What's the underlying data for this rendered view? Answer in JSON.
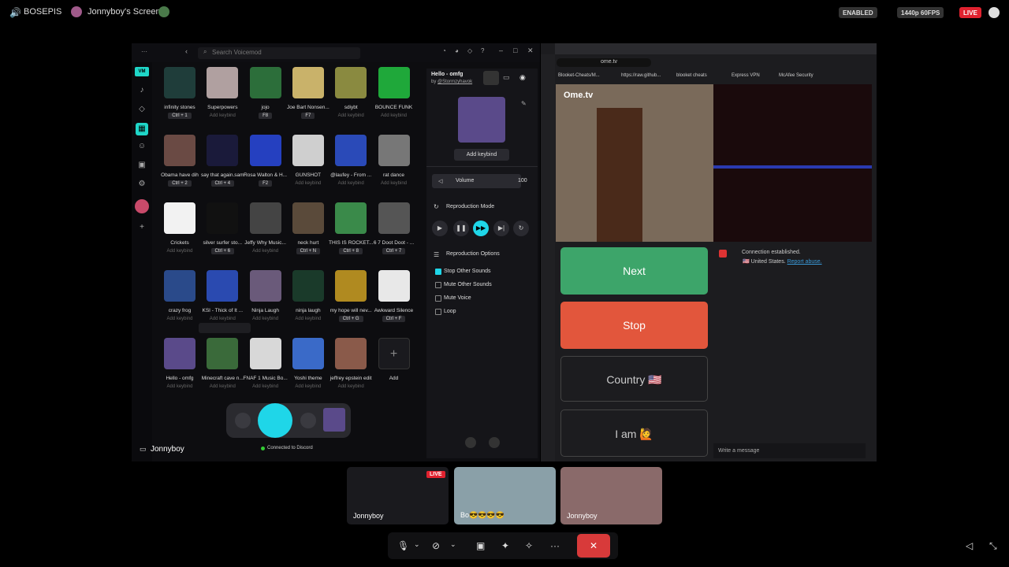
{
  "topbar": {
    "server": "BOSEPIS",
    "screen_title": "Jonnyboy's Screen",
    "enabled": "ENABLED",
    "quality": "1440p 60FPS",
    "live": "LIVE"
  },
  "voicemod": {
    "search_placeholder": "Search Voicemod",
    "user": "Jonnyboy",
    "status": "Connected to Discord",
    "sounds": [
      {
        "name": "infinity stones",
        "key": "Ctrl + 1",
        "color": "#1f3d3a"
      },
      {
        "name": "Superpowers",
        "key": "Add keybind",
        "color": "#b0a0a0"
      },
      {
        "name": "jojo",
        "key": "F8",
        "color": "#2c6e3a"
      },
      {
        "name": "Joe Bart Nonsen...",
        "key": "F7",
        "color": "#c9b26a"
      },
      {
        "name": "sdiybt",
        "key": "Add keybind",
        "color": "#8a8a40"
      },
      {
        "name": "BOUNCE FUNK",
        "key": "Add keybind",
        "color": "#1fa83a"
      },
      {
        "name": "Obama have dih",
        "key": "Ctrl + 2",
        "color": "#6a4a44"
      },
      {
        "name": "say that again.sam",
        "key": "Ctrl + 4",
        "color": "#1a1a3a"
      },
      {
        "name": "Rosa Walton & H...",
        "key": "F2",
        "color": "#2540c0"
      },
      {
        "name": "GUNSHOT",
        "key": "Add keybind",
        "color": "#cfcfcf"
      },
      {
        "name": "@laufey - From ...",
        "key": "Add keybind",
        "color": "#2a4ab8"
      },
      {
        "name": "rat dance",
        "key": "Add keybind",
        "color": "#777"
      },
      {
        "name": "Crickets",
        "key": "Add keybind",
        "color": "#f2f2f2"
      },
      {
        "name": "silver surfer sto...",
        "key": "Ctrl + 6",
        "color": "#111"
      },
      {
        "name": "Jeffy Why Music...",
        "key": "Add keybind",
        "color": "#444"
      },
      {
        "name": "neck hurt",
        "key": "Ctrl + N",
        "color": "#5a4a3a"
      },
      {
        "name": "THIS IS ROCKET...",
        "key": "Ctrl + 8",
        "color": "#3a8a4a"
      },
      {
        "name": "6 7 Doot Doot - ...",
        "key": "Ctrl + 7",
        "color": "#555"
      },
      {
        "name": "crazy frog",
        "key": "Add keybind",
        "color": "#2a4a8a"
      },
      {
        "name": "KSI - Thick of It ...",
        "key": "Add keybind",
        "color": "#2a4ab0"
      },
      {
        "name": "Ninja Laugh",
        "key": "Add keybind",
        "color": "#6a5a7a"
      },
      {
        "name": "ninja laugh",
        "key": "Add keybind",
        "color": "#1a3a2a"
      },
      {
        "name": "my hope will nev...",
        "key": "Ctrl + G",
        "color": "#b08a20"
      },
      {
        "name": "Awkward Silence",
        "key": "Ctrl + F",
        "color": "#e8e8e8"
      },
      {
        "name": "Hello - omfg",
        "key": "Add keybind",
        "color": "#5a4a8a"
      },
      {
        "name": "Minecraft cave n...",
        "key": "Add keybind",
        "color": "#3a6a3a"
      },
      {
        "name": "FNAF 1 Music Bo...",
        "key": "Add keybind",
        "color": "#d8d8d8"
      },
      {
        "name": "Yoshi theme",
        "key": "Add keybind",
        "color": "#3a6ac8"
      },
      {
        "name": "jeffrey epstein edit",
        "key": "Add keybind",
        "color": "#8a5a4a"
      },
      {
        "name": "Add",
        "key": "",
        "color": "#1a1a1e"
      }
    ],
    "selected": {
      "title": "Hello - omfg",
      "author": "@Stormzyhavok",
      "by": "by",
      "add_keybind": "Add keybind",
      "volume_label": "Volume",
      "volume": "100",
      "repro_mode": "Reproduction Mode",
      "repro_options": "Reproduction Options",
      "opts": [
        "Stop Other Sounds",
        "Mute Other Sounds",
        "Mute Voice",
        "Loop"
      ]
    }
  },
  "browser": {
    "url": "ome.tv",
    "bookmarks": [
      "Blooket-Cheats/M...",
      "https://raw.github...",
      "blooket cheats",
      "Express VPN",
      "McAfee Security"
    ],
    "site": "Ome.tv",
    "next": "Next",
    "stop": "Stop",
    "country": "Country",
    "country_flag": "🇺🇸",
    "iam": "I am",
    "iam_emoji": "🙋",
    "conn1": "Connection established.",
    "conn2": "United States.",
    "report": "Report abuse.",
    "chat_placeholder": "Write a message"
  },
  "tiles": [
    {
      "name": "Jonnyboy",
      "live": "LIVE"
    },
    {
      "name": "Bo😎😎😎😎"
    },
    {
      "name": "Jonnyboy"
    }
  ]
}
